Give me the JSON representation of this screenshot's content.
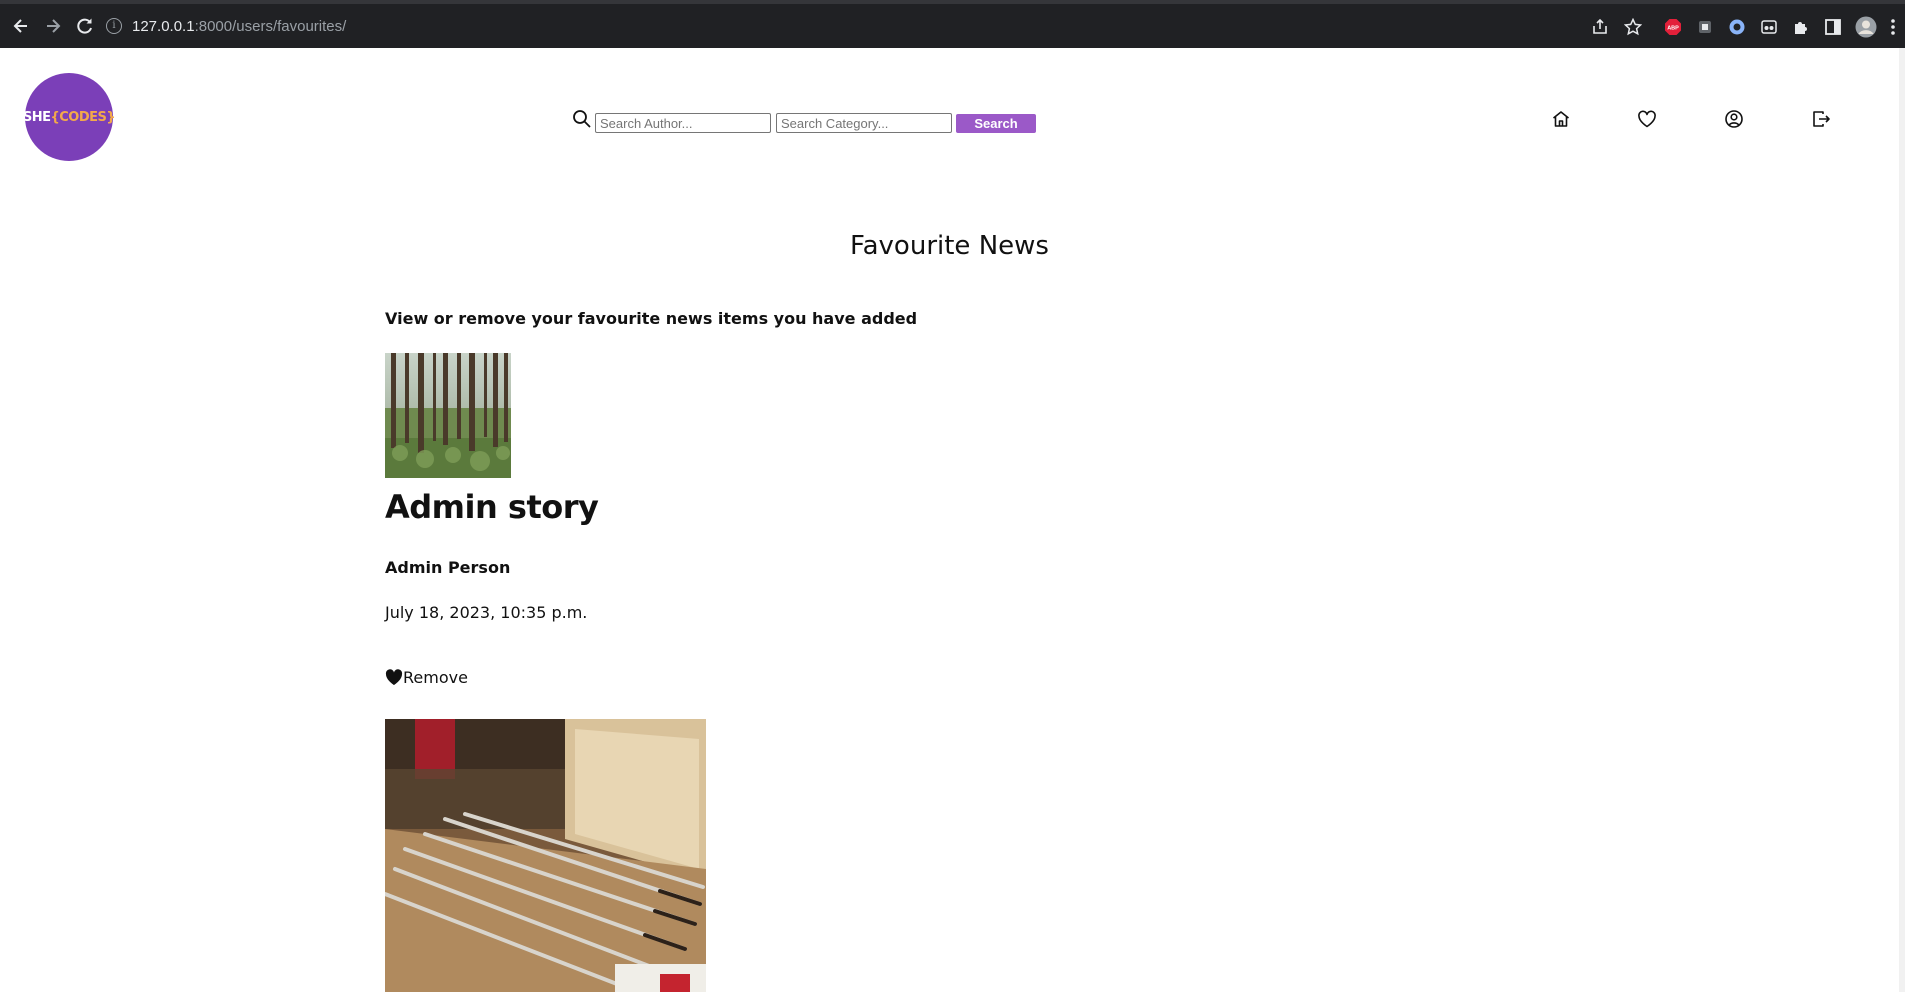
{
  "browser": {
    "url_host": "127.0.0.1",
    "url_path": ":8000/users/favourites/",
    "extensions": [
      "share-icon",
      "star-icon",
      "adblock-icon",
      "extension-icon",
      "extension-icon",
      "extension-icon",
      "puzzle-icon",
      "sidebar-icon",
      "profile-avatar"
    ]
  },
  "header": {
    "logo": {
      "part1": "SHE",
      "part2": "{CODES}"
    },
    "search": {
      "author_placeholder": "Search Author...",
      "category_placeholder": "Search Category...",
      "button_label": "Search"
    },
    "nav_icons": [
      "home-icon",
      "heart-icon",
      "user-icon",
      "logout-icon"
    ]
  },
  "main": {
    "title": "Favourite News",
    "subtitle": "View or remove your favourite news items you have added",
    "items": [
      {
        "image": "forest",
        "title": "Admin story",
        "author": "Admin Person",
        "date": "July 18, 2023, 10:35 p.m.",
        "remove_label": "Remove"
      },
      {
        "image": "pens-and-box"
      }
    ]
  },
  "colors": {
    "brand_purple": "#7b3fb8",
    "button_purple": "#9b59c8",
    "logo_accent": "#f3a94a",
    "chrome_bg": "#202124"
  }
}
